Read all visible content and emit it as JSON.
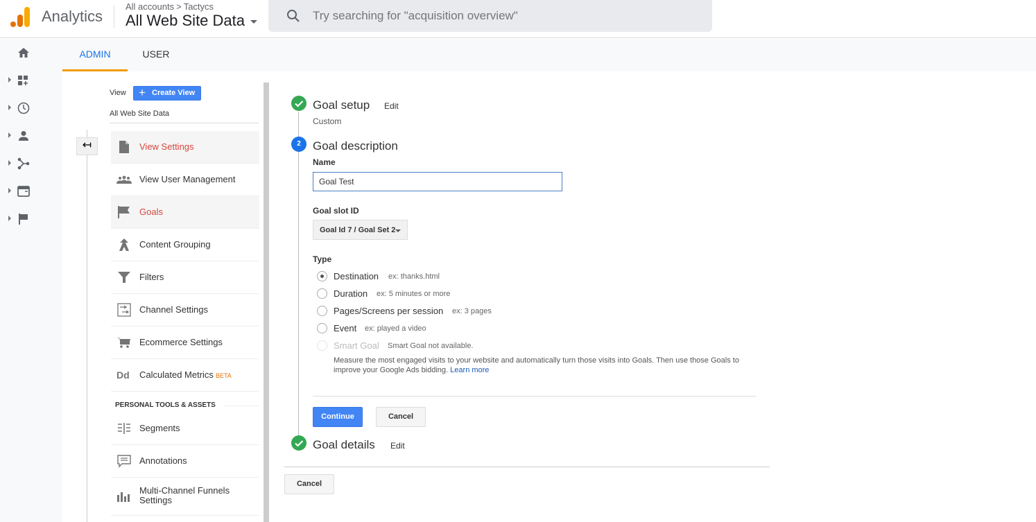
{
  "header": {
    "app_name": "Analytics",
    "breadcrumb": {
      "all_accounts": "All accounts",
      "separator": ">",
      "account": "Tactycs"
    },
    "view_selector": "All Web Site Data",
    "search_placeholder": "Try searching for \"acquisition overview\""
  },
  "leftnav": {
    "items": [
      {
        "icon": "home-icon"
      },
      {
        "icon": "customization-icon"
      },
      {
        "icon": "realtime-clock-icon"
      },
      {
        "icon": "audience-person-icon"
      },
      {
        "icon": "acquisition-icon"
      },
      {
        "icon": "behavior-icon"
      },
      {
        "icon": "conversions-flag-icon"
      }
    ]
  },
  "tabs": [
    {
      "label": "ADMIN",
      "active": true
    },
    {
      "label": "USER",
      "active": false
    }
  ],
  "admin_column": {
    "view_label": "View",
    "create_view_label": "Create View",
    "view_name": "All Web Site Data",
    "back_icon": "↤",
    "menu": [
      {
        "label": "View Settings",
        "icon": "document-icon",
        "active": true
      },
      {
        "label": "View User Management",
        "icon": "users-icon",
        "active": false
      },
      {
        "label": "Goals",
        "icon": "flag-icon",
        "active": true
      },
      {
        "label": "Content Grouping",
        "icon": "content-grouping-icon",
        "active": false
      },
      {
        "label": "Filters",
        "icon": "filter-icon",
        "active": false
      },
      {
        "label": "Channel Settings",
        "icon": "channel-settings-icon",
        "active": false
      },
      {
        "label": "Ecommerce Settings",
        "icon": "cart-icon",
        "active": false
      },
      {
        "label": "Calculated Metrics",
        "badge": "BETA",
        "icon": "dd-icon",
        "active": false
      }
    ],
    "section_header": "PERSONAL TOOLS & ASSETS",
    "personal_menu": [
      {
        "label": "Segments",
        "icon": "segments-icon"
      },
      {
        "label": "Annotations",
        "icon": "annotation-icon"
      },
      {
        "label": "Multi-Channel Funnels Settings",
        "icon": "bar-chart-icon"
      }
    ]
  },
  "goal_form": {
    "step1": {
      "title": "Goal setup",
      "edit": "Edit",
      "subtitle": "Custom",
      "status": "complete"
    },
    "step2": {
      "number": "2",
      "title": "Goal description",
      "name_label": "Name",
      "name_value": "Goal Test",
      "slot_label": "Goal slot ID",
      "slot_value": "Goal Id 7 / Goal Set 2",
      "type_label": "Type",
      "types": [
        {
          "label": "Destination",
          "example": "ex: thanks.html",
          "selected": true,
          "disabled": false
        },
        {
          "label": "Duration",
          "example": "ex: 5 minutes or more",
          "selected": false,
          "disabled": false
        },
        {
          "label": "Pages/Screens per session",
          "example": "ex: 3 pages",
          "selected": false,
          "disabled": false
        },
        {
          "label": "Event",
          "example": "ex: played a video",
          "selected": false,
          "disabled": false
        },
        {
          "label": "Smart Goal",
          "example": "Smart Goal not available.",
          "selected": false,
          "disabled": true
        }
      ],
      "smart_goal_desc": "Measure the most engaged visits to your website and automatically turn those visits into Goals. Then use those Goals to improve your Google Ads bidding.",
      "learn_more": "Learn more",
      "continue_label": "Continue",
      "cancel_label": "Cancel"
    },
    "step3": {
      "title": "Goal details",
      "edit": "Edit",
      "status": "complete"
    },
    "footer_cancel": "Cancel"
  },
  "colors": {
    "accent_blue": "#4285f4",
    "active_tab": "#1a73e8",
    "tab_underline": "#f29900",
    "active_menu_text": "#d6463e",
    "complete_green": "#34a853"
  }
}
